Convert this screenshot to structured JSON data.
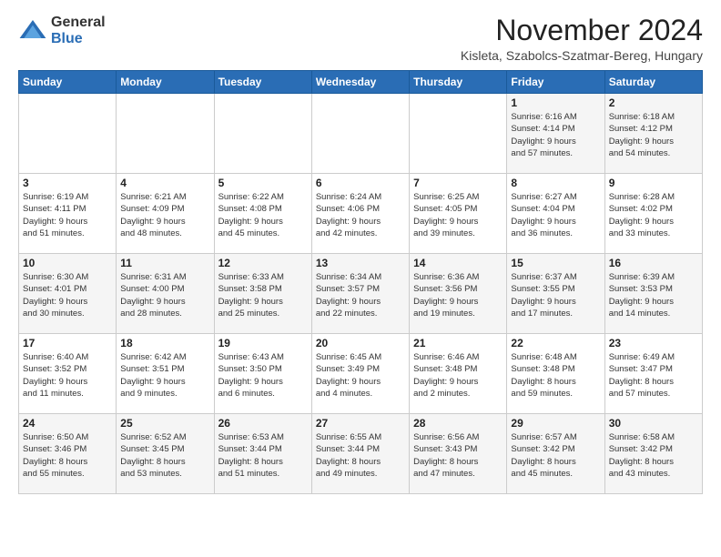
{
  "header": {
    "logo_general": "General",
    "logo_blue": "Blue",
    "month_title": "November 2024",
    "subtitle": "Kisleta, Szabolcs-Szatmar-Bereg, Hungary"
  },
  "days_of_week": [
    "Sunday",
    "Monday",
    "Tuesday",
    "Wednesday",
    "Thursday",
    "Friday",
    "Saturday"
  ],
  "weeks": [
    [
      {
        "day": "",
        "info": ""
      },
      {
        "day": "",
        "info": ""
      },
      {
        "day": "",
        "info": ""
      },
      {
        "day": "",
        "info": ""
      },
      {
        "day": "",
        "info": ""
      },
      {
        "day": "1",
        "info": "Sunrise: 6:16 AM\nSunset: 4:14 PM\nDaylight: 9 hours\nand 57 minutes."
      },
      {
        "day": "2",
        "info": "Sunrise: 6:18 AM\nSunset: 4:12 PM\nDaylight: 9 hours\nand 54 minutes."
      }
    ],
    [
      {
        "day": "3",
        "info": "Sunrise: 6:19 AM\nSunset: 4:11 PM\nDaylight: 9 hours\nand 51 minutes."
      },
      {
        "day": "4",
        "info": "Sunrise: 6:21 AM\nSunset: 4:09 PM\nDaylight: 9 hours\nand 48 minutes."
      },
      {
        "day": "5",
        "info": "Sunrise: 6:22 AM\nSunset: 4:08 PM\nDaylight: 9 hours\nand 45 minutes."
      },
      {
        "day": "6",
        "info": "Sunrise: 6:24 AM\nSunset: 4:06 PM\nDaylight: 9 hours\nand 42 minutes."
      },
      {
        "day": "7",
        "info": "Sunrise: 6:25 AM\nSunset: 4:05 PM\nDaylight: 9 hours\nand 39 minutes."
      },
      {
        "day": "8",
        "info": "Sunrise: 6:27 AM\nSunset: 4:04 PM\nDaylight: 9 hours\nand 36 minutes."
      },
      {
        "day": "9",
        "info": "Sunrise: 6:28 AM\nSunset: 4:02 PM\nDaylight: 9 hours\nand 33 minutes."
      }
    ],
    [
      {
        "day": "10",
        "info": "Sunrise: 6:30 AM\nSunset: 4:01 PM\nDaylight: 9 hours\nand 30 minutes."
      },
      {
        "day": "11",
        "info": "Sunrise: 6:31 AM\nSunset: 4:00 PM\nDaylight: 9 hours\nand 28 minutes."
      },
      {
        "day": "12",
        "info": "Sunrise: 6:33 AM\nSunset: 3:58 PM\nDaylight: 9 hours\nand 25 minutes."
      },
      {
        "day": "13",
        "info": "Sunrise: 6:34 AM\nSunset: 3:57 PM\nDaylight: 9 hours\nand 22 minutes."
      },
      {
        "day": "14",
        "info": "Sunrise: 6:36 AM\nSunset: 3:56 PM\nDaylight: 9 hours\nand 19 minutes."
      },
      {
        "day": "15",
        "info": "Sunrise: 6:37 AM\nSunset: 3:55 PM\nDaylight: 9 hours\nand 17 minutes."
      },
      {
        "day": "16",
        "info": "Sunrise: 6:39 AM\nSunset: 3:53 PM\nDaylight: 9 hours\nand 14 minutes."
      }
    ],
    [
      {
        "day": "17",
        "info": "Sunrise: 6:40 AM\nSunset: 3:52 PM\nDaylight: 9 hours\nand 11 minutes."
      },
      {
        "day": "18",
        "info": "Sunrise: 6:42 AM\nSunset: 3:51 PM\nDaylight: 9 hours\nand 9 minutes."
      },
      {
        "day": "19",
        "info": "Sunrise: 6:43 AM\nSunset: 3:50 PM\nDaylight: 9 hours\nand 6 minutes."
      },
      {
        "day": "20",
        "info": "Sunrise: 6:45 AM\nSunset: 3:49 PM\nDaylight: 9 hours\nand 4 minutes."
      },
      {
        "day": "21",
        "info": "Sunrise: 6:46 AM\nSunset: 3:48 PM\nDaylight: 9 hours\nand 2 minutes."
      },
      {
        "day": "22",
        "info": "Sunrise: 6:48 AM\nSunset: 3:48 PM\nDaylight: 8 hours\nand 59 minutes."
      },
      {
        "day": "23",
        "info": "Sunrise: 6:49 AM\nSunset: 3:47 PM\nDaylight: 8 hours\nand 57 minutes."
      }
    ],
    [
      {
        "day": "24",
        "info": "Sunrise: 6:50 AM\nSunset: 3:46 PM\nDaylight: 8 hours\nand 55 minutes."
      },
      {
        "day": "25",
        "info": "Sunrise: 6:52 AM\nSunset: 3:45 PM\nDaylight: 8 hours\nand 53 minutes."
      },
      {
        "day": "26",
        "info": "Sunrise: 6:53 AM\nSunset: 3:44 PM\nDaylight: 8 hours\nand 51 minutes."
      },
      {
        "day": "27",
        "info": "Sunrise: 6:55 AM\nSunset: 3:44 PM\nDaylight: 8 hours\nand 49 minutes."
      },
      {
        "day": "28",
        "info": "Sunrise: 6:56 AM\nSunset: 3:43 PM\nDaylight: 8 hours\nand 47 minutes."
      },
      {
        "day": "29",
        "info": "Sunrise: 6:57 AM\nSunset: 3:42 PM\nDaylight: 8 hours\nand 45 minutes."
      },
      {
        "day": "30",
        "info": "Sunrise: 6:58 AM\nSunset: 3:42 PM\nDaylight: 8 hours\nand 43 minutes."
      }
    ]
  ]
}
